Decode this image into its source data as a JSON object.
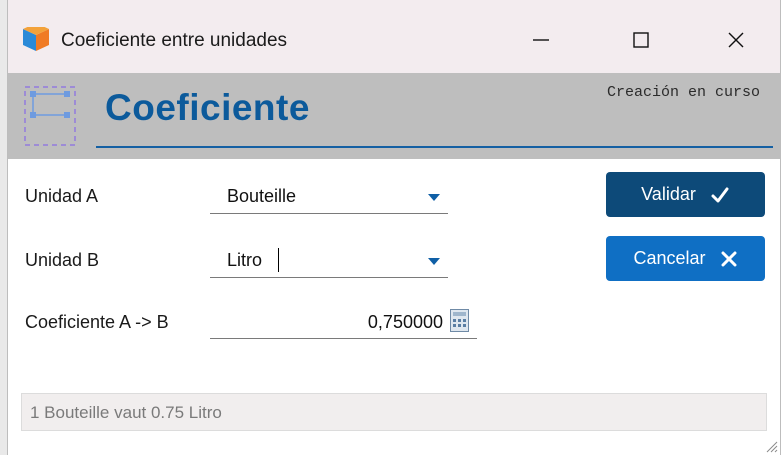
{
  "window": {
    "title": "Coeficiente entre unidades",
    "icon": "app-logo-icon",
    "controls": [
      "minimize-icon",
      "maximize-icon",
      "close-icon"
    ]
  },
  "header": {
    "title": "Coeficiente",
    "status": "Creación en curso",
    "icon": "form-frame-icon"
  },
  "form": {
    "unit_a": {
      "label": "Unidad A",
      "value": "Bouteille"
    },
    "unit_b": {
      "label": "Unidad B",
      "value": "Litro"
    },
    "coefficient": {
      "label": "Coeficiente A -> B",
      "value": "0,750000",
      "icon": "calculator-icon"
    }
  },
  "actions": {
    "validate_label": "Validar",
    "cancel_label": "Cancelar"
  },
  "info": {
    "text": "1 Bouteille vaut 0.75 Litro"
  },
  "colors": {
    "accent": "#0c5a9b",
    "validate_bg": "#0d4a79",
    "cancel_bg": "#0f6fc4",
    "header_band": "#bebebe",
    "titlebar": "#f3ecef"
  }
}
